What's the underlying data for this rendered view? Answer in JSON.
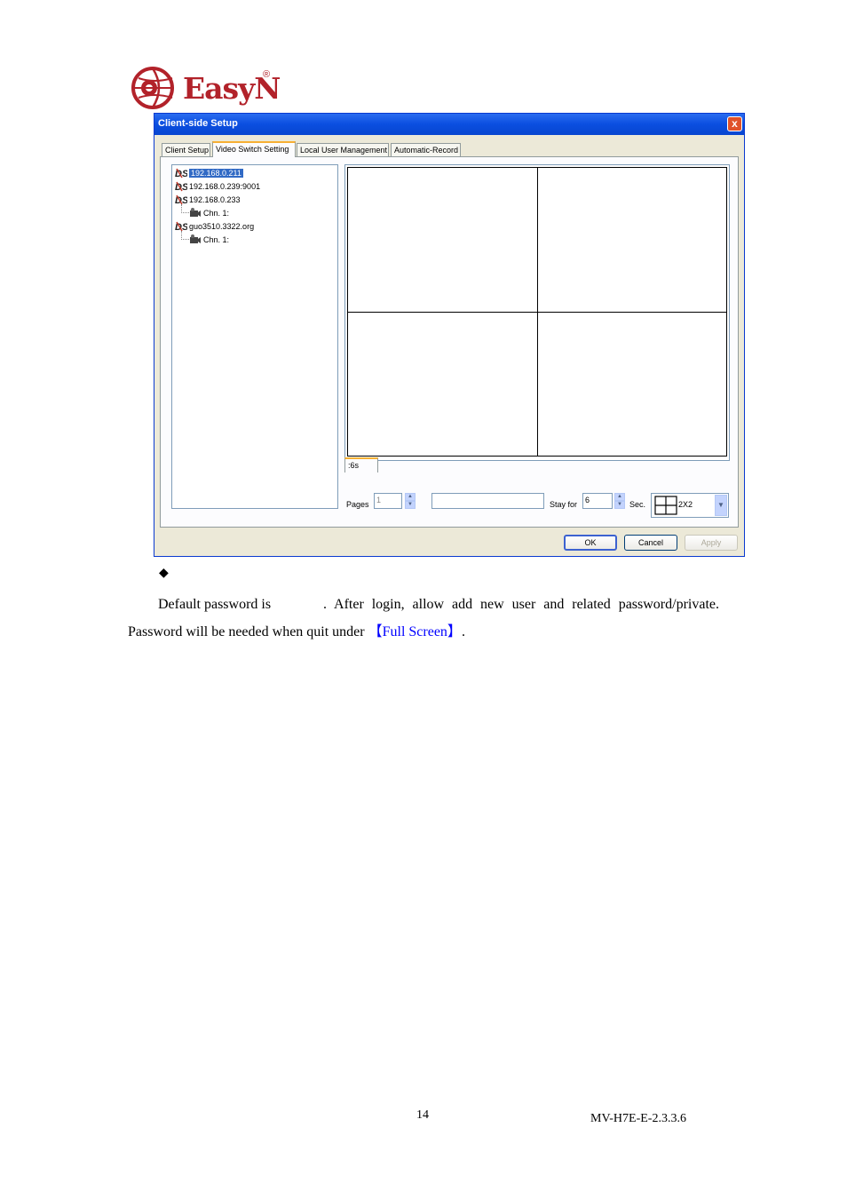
{
  "logo": {
    "text": "EasyN",
    "registered": "®"
  },
  "dialog": {
    "title": "Client-side Setup",
    "close": "x",
    "tabs": [
      "Client Setup",
      "Video Switch Setting",
      "Local User Management",
      "Automatic-Record"
    ],
    "active_tab": "Video Switch Setting",
    "tree": [
      {
        "label": "192.168.0.211",
        "selected": true
      },
      {
        "label": "192.168.0.239:9001"
      },
      {
        "label": "192.168.0.233"
      },
      {
        "label": "Chn. 1:"
      },
      {
        "label": "guo3510.3322.org"
      },
      {
        "label": "Chn. 1:"
      }
    ],
    "page_tab": ":6s",
    "pages_label": "Pages",
    "pages_value": "1",
    "stay_label": "Stay for",
    "stay_value": "6",
    "sec_label": "Sec.",
    "layout_value": "2X2",
    "buttons": {
      "ok": "OK",
      "cancel": "Cancel",
      "apply": "Apply"
    }
  },
  "body": {
    "bullet": "◆",
    "para1_a": "Default password is",
    "para1_b": ". After login, allow add new user and related password/private.",
    "para2_a": "Password will be needed when quit under",
    "para2_link": "【Full Screen】",
    "para2_b": "."
  },
  "footer": {
    "page_number": "14",
    "doc_id": "MV-H7E-E-2.3.3.6"
  }
}
